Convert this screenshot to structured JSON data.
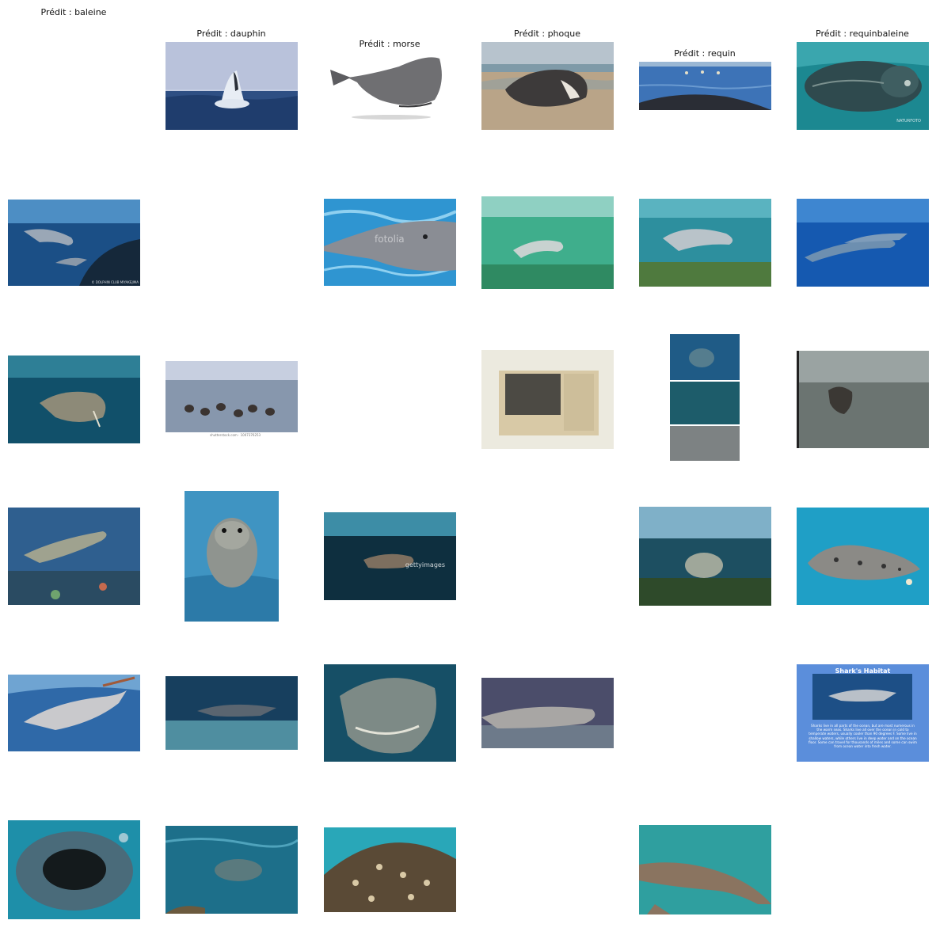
{
  "titles": [
    "Prédit : baleine",
    "Prédit : dauphin",
    "Prédit : morse",
    "Prédit : phoque",
    "Prédit : requin",
    "Prédit : requinbaleine"
  ],
  "watermarks": {
    "naturfoto": "NATURFOTO",
    "dolphin_club": "© DOLPHIN CLUB MIYAKEJIMA",
    "fotolia": "fotolia",
    "shutterstock": "shutterstock.com · 1007376253",
    "gettyimages": "gettyimages"
  },
  "slide": {
    "title": "Shark's Habitat",
    "text": "Sharks live in all parts of the ocean, but are most numerous in the warm seas. Sharks live all over the ocean in cold to temperate waters, usually cooler than 90 degrees F. Some live in shallow waters, while others live in deep water and on the ocean floor. Some can travel for thousands of miles and some can swim from ocean water into fresh water."
  }
}
